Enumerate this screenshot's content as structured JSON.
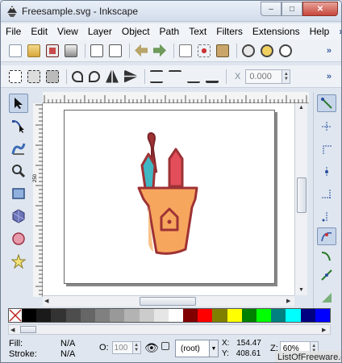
{
  "window": {
    "title": "Freesample.svg - Inkscape",
    "min_label": "–",
    "max_label": "□",
    "close_label": "✕"
  },
  "menu": {
    "items": [
      "File",
      "Edit",
      "View",
      "Layer",
      "Object",
      "Path",
      "Text",
      "Filters",
      "Extensions",
      "Help"
    ],
    "more": "»"
  },
  "commands_toolbar": {
    "icons": [
      "new-document-icon",
      "open-folder-icon",
      "save-icon",
      "print-icon",
      "import-icon",
      "export-icon",
      "undo-icon",
      "redo-icon",
      "copy-icon",
      "cut-icon",
      "paste-icon",
      "zoom-selection-icon",
      "zoom-drawing-icon",
      "zoom-page-icon"
    ],
    "more": "»"
  },
  "selector_toolbar": {
    "icons": [
      "select-all-icon",
      "select-all-layers-icon",
      "deselect-icon",
      "rotate-ccw-icon",
      "rotate-cw-icon",
      "flip-horizontal-icon",
      "flip-vertical-icon",
      "raise-to-top-icon",
      "raise-icon",
      "lower-icon",
      "lower-to-bottom-icon"
    ],
    "x_label": "X",
    "x_value": "0.000",
    "more": "»"
  },
  "tools": [
    "selector-tool-icon",
    "node-tool-icon",
    "tweak-tool-icon",
    "zoom-tool-icon",
    "rectangle-tool-icon",
    "3d-box-tool-icon",
    "ellipse-tool-icon",
    "star-tool-icon"
  ],
  "snap_controls": [
    "snap-toggle-icon",
    "snap-bbox-icon",
    "snap-bbox-edge-icon",
    "snap-bbox-corner-icon",
    "snap-bbox-midpoint-icon",
    "snap-bbox-center-icon",
    "snap-nodes-icon",
    "snap-path-icon",
    "snap-cusp-node-icon"
  ],
  "ruler": {
    "v_label": "250"
  },
  "palette": {
    "none_icon": "no-paint-icon",
    "swatches": [
      "#000000",
      "#1a1a1a",
      "#333333",
      "#4d4d4d",
      "#666666",
      "#808080",
      "#999999",
      "#b3b3b3",
      "#cccccc",
      "#e6e6e6",
      "#ffffff",
      "#800000",
      "#ff0000",
      "#808000",
      "#ffff00",
      "#008000",
      "#00ff00",
      "#008080",
      "#00ffff",
      "#000080",
      "#0000ff"
    ]
  },
  "status": {
    "fill_label": "Fill:",
    "fill_value": "N/A",
    "stroke_label": "Stroke:",
    "stroke_value": "N/A",
    "opacity_label": "O:",
    "opacity_value": "100",
    "layer_value": "(root)",
    "x_label": "X:",
    "x_value": "154.47",
    "y_label": "Y:",
    "y_value": "408.61",
    "zoom_label": "Z:",
    "zoom_value": "60%"
  },
  "watermark": "ListOfFreeware.com"
}
